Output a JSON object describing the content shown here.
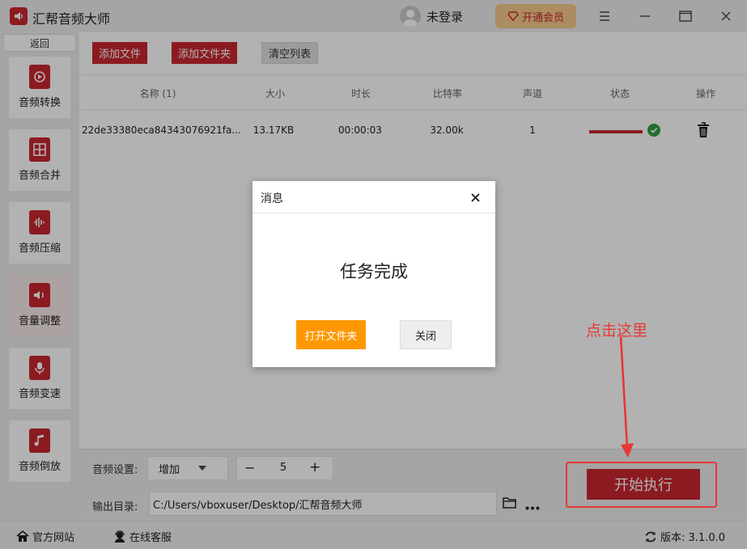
{
  "app": {
    "title": "汇帮音频大师",
    "login_label": "未登录",
    "vip_label": "开通会员"
  },
  "sidebar": {
    "back_label": "返回",
    "items": [
      {
        "label": "音频转换",
        "icon": "audio-convert-icon"
      },
      {
        "label": "音频合并",
        "icon": "audio-merge-icon"
      },
      {
        "label": "音频压缩",
        "icon": "audio-compress-icon"
      },
      {
        "label": "音量调整",
        "icon": "volume-adjust-icon"
      },
      {
        "label": "音频变速",
        "icon": "audio-speed-icon"
      },
      {
        "label": "音频倒放",
        "icon": "audio-reverse-icon"
      }
    ]
  },
  "toolbar": {
    "add_file": "添加文件",
    "add_folder": "添加文件夹",
    "clear_list": "清空列表"
  },
  "table": {
    "headers": [
      "名称 (1)",
      "大小",
      "时长",
      "比特率",
      "声道",
      "状态",
      "操作"
    ],
    "rows": [
      {
        "name": "22de33380eca84343076921fa...",
        "size": "13.17KB",
        "duration": "00:00:03",
        "bitrate": "32.00k",
        "channels": "1",
        "progress": 1.0
      }
    ]
  },
  "settings": {
    "audio_label": "音频设置:",
    "mode_value": "增加",
    "step_value": "5",
    "minus_label": "−",
    "plus_label": "+",
    "output_label": "输出目录:",
    "output_path": "C:/Users/vboxuser/Desktop/汇帮音频大师",
    "start_label": "开始执行"
  },
  "annotation": {
    "text": "点击这里"
  },
  "status": {
    "website": "官方网站",
    "support": "在线客服",
    "version": "版本: 3.1.0.0"
  },
  "dialog": {
    "title": "消息",
    "message": "任务完成",
    "open_folder": "打开文件夹",
    "close": "关闭"
  },
  "colors": {
    "brand": "#c8282e",
    "accent_orange": "#ff9800",
    "vip_bg": "#f7c98c",
    "annotation": "#e53935",
    "success": "#2e9e46"
  }
}
